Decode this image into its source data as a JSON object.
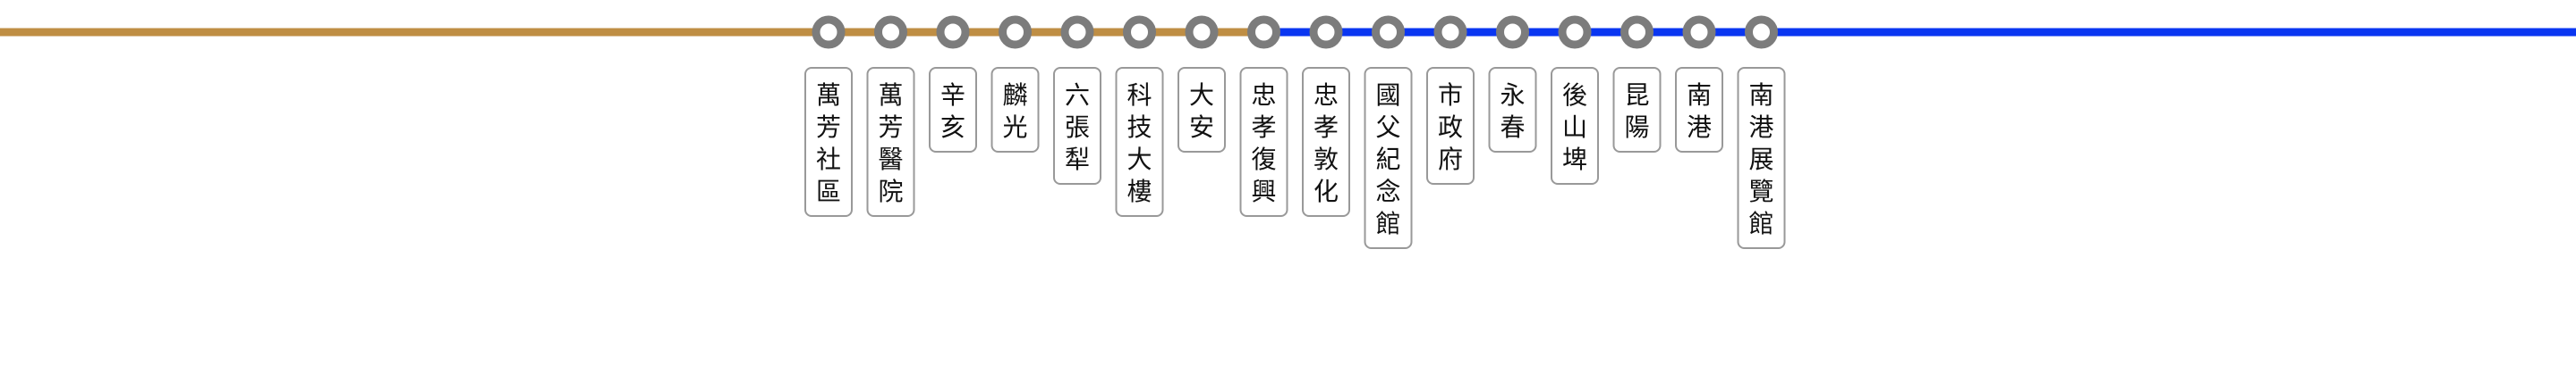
{
  "lines": [
    {
      "name": "",
      "color": "#BF8E44",
      "from_station": 0,
      "to_station": 7,
      "extends_left": true
    },
    {
      "name": "",
      "color": "#0A36F1",
      "from_station": 7,
      "to_station": 15,
      "extends_right": true
    }
  ],
  "marker_color": "#7C7C7C",
  "stations": [
    {
      "name": "萬芳社區"
    },
    {
      "name": "萬芳醫院"
    },
    {
      "name": "辛亥"
    },
    {
      "name": "麟光"
    },
    {
      "name": "六張犁"
    },
    {
      "name": "科技大樓"
    },
    {
      "name": "大安"
    },
    {
      "name": "忠孝復興"
    },
    {
      "name": "忠孝敦化"
    },
    {
      "name": "國父紀念館"
    },
    {
      "name": "市政府"
    },
    {
      "name": "永春"
    },
    {
      "name": "後山埤"
    },
    {
      "name": "昆陽"
    },
    {
      "name": "南港"
    },
    {
      "name": "南港展覽館"
    }
  ]
}
